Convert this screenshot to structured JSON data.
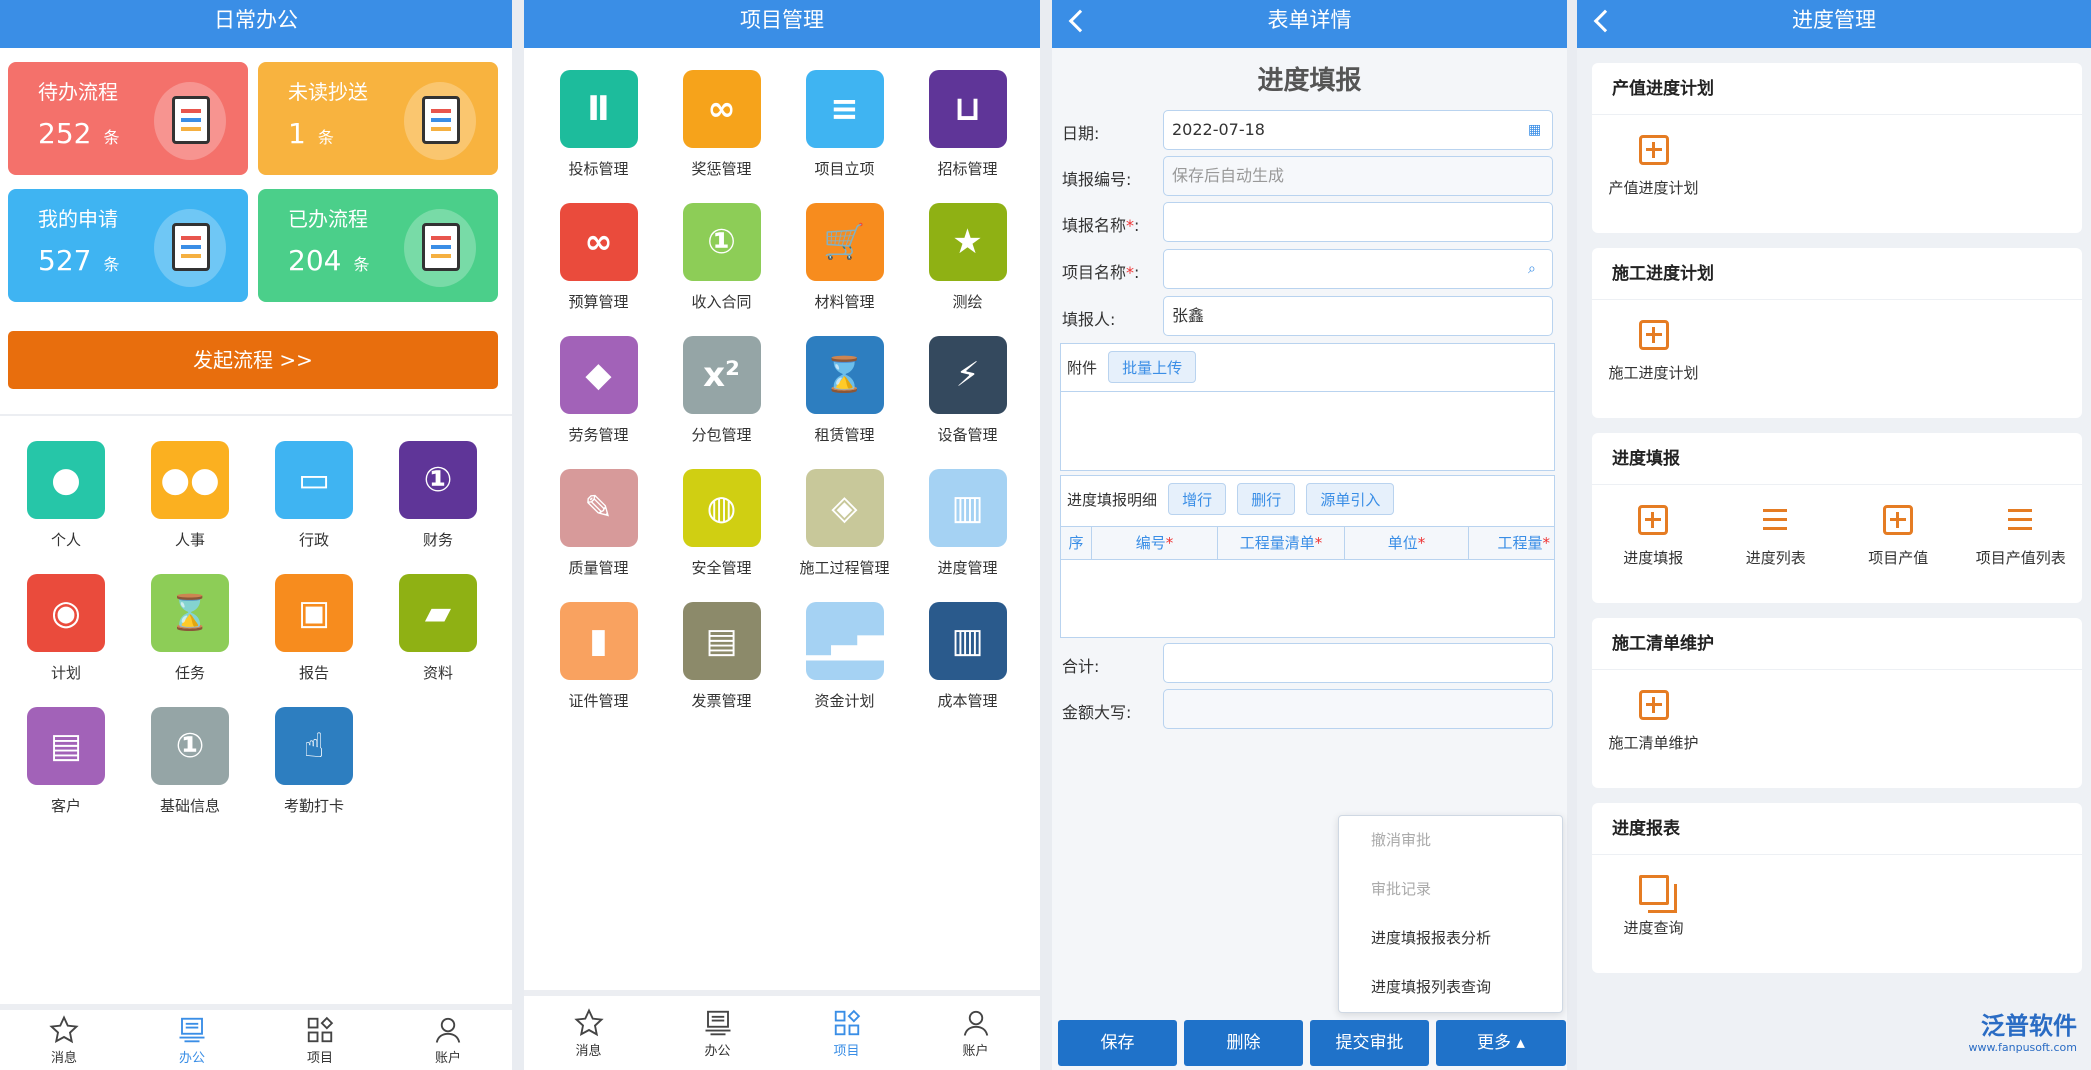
{
  "office": {
    "title": "日常办公",
    "cards": [
      {
        "label": "待办流程",
        "count": "252",
        "unit": "条",
        "color": "#f4716b",
        "icon": "calendar-icon"
      },
      {
        "label": "未读抄送",
        "count": "1",
        "unit": "条",
        "color": "#f8b33f",
        "icon": "envelope-icon"
      },
      {
        "label": "我的申请",
        "count": "527",
        "unit": "条",
        "color": "#3fb4f2",
        "icon": "binders-icon"
      },
      {
        "label": "已办流程",
        "count": "204",
        "unit": "条",
        "color": "#4bcf8a",
        "icon": "clipboard-icon"
      }
    ],
    "start_button": "发起流程 >>",
    "apps": [
      {
        "label": "个人",
        "color": "#26c6a8",
        "icon": "person-icon",
        "glyph": "●"
      },
      {
        "label": "人事",
        "color": "#fbb020",
        "icon": "group-icon",
        "glyph": "●●"
      },
      {
        "label": "行政",
        "color": "#3fb4f2",
        "icon": "window-icon",
        "glyph": "▭"
      },
      {
        "label": "财务",
        "color": "#5f3598",
        "icon": "money-icon",
        "glyph": "①"
      },
      {
        "label": "计划",
        "color": "#ea4b3c",
        "icon": "github-icon",
        "glyph": "◉"
      },
      {
        "label": "任务",
        "color": "#8dcd57",
        "icon": "hourglass-icon",
        "glyph": "⌛"
      },
      {
        "label": "报告",
        "color": "#f78c1e",
        "icon": "monitor-icon",
        "glyph": "▣"
      },
      {
        "label": "资料",
        "color": "#8fb114",
        "icon": "folder-icon",
        "glyph": "▰"
      },
      {
        "label": "客户",
        "color": "#a262b8",
        "icon": "contact-icon",
        "glyph": "▤"
      },
      {
        "label": "基础信息",
        "color": "#95a5a6",
        "icon": "cash-icon",
        "glyph": "①"
      },
      {
        "label": "考勤打卡",
        "color": "#2d7ec0",
        "icon": "hand-pointer-icon",
        "glyph": "☝"
      }
    ],
    "tabs": [
      {
        "label": "消息",
        "icon": "star-icon"
      },
      {
        "label": "办公",
        "icon": "desk-icon"
      },
      {
        "label": "项目",
        "icon": "grid-icon"
      },
      {
        "label": "账户",
        "icon": "user-icon"
      }
    ]
  },
  "project": {
    "title": "项目管理",
    "apps": [
      {
        "label": "投标管理",
        "color": "#1dbc9c",
        "icon": "road-icon",
        "glyph": "Ⅱ"
      },
      {
        "label": "奖惩管理",
        "color": "#f6a31b",
        "icon": "cloud-icon",
        "glyph": "∞"
      },
      {
        "label": "项目立项",
        "color": "#3fb4f2",
        "icon": "message-icon",
        "glyph": "≡"
      },
      {
        "label": "招标管理",
        "color": "#5f3598",
        "icon": "inbox-icon",
        "glyph": "⊔"
      },
      {
        "label": "预算管理",
        "color": "#ea4b3c",
        "icon": "cloud-icon",
        "glyph": "∞"
      },
      {
        "label": "收入合同",
        "color": "#8dcd57",
        "icon": "money-icon",
        "glyph": "①"
      },
      {
        "label": "材料管理",
        "color": "#f78c1e",
        "icon": "cart-icon",
        "glyph": "🛒"
      },
      {
        "label": "测绘",
        "color": "#8fb114",
        "icon": "star-icon",
        "glyph": "★"
      },
      {
        "label": "劳务管理",
        "color": "#a262b8",
        "icon": "gitlab-icon",
        "glyph": "◆"
      },
      {
        "label": "分包管理",
        "color": "#95a5a6",
        "icon": "superscript-icon",
        "glyph": "x²"
      },
      {
        "label": "租赁管理",
        "color": "#2d7ec0",
        "icon": "hourglass-icon",
        "glyph": "⌛"
      },
      {
        "label": "设备管理",
        "color": "#34495e",
        "icon": "plug-icon",
        "glyph": "⚡"
      },
      {
        "label": "质量管理",
        "color": "#d79a9a",
        "icon": "edit-icon",
        "glyph": "✎"
      },
      {
        "label": "安全管理",
        "color": "#d0cf12",
        "icon": "chat-icon",
        "glyph": "◍"
      },
      {
        "label": "施工过程管理",
        "color": "#c8c89a",
        "icon": "compass-icon",
        "glyph": "◈"
      },
      {
        "label": "进度管理",
        "color": "#a5d2f3",
        "icon": "bar-chart-icon",
        "glyph": "▥"
      },
      {
        "label": "证件管理",
        "color": "#f9a260",
        "icon": "tie-icon",
        "glyph": "▮"
      },
      {
        "label": "发票管理",
        "color": "#8c8a6a",
        "icon": "file-icon",
        "glyph": "▤"
      },
      {
        "label": "资金计划",
        "color": "#a5d2f3",
        "icon": "signal-icon",
        "glyph": "▁▃▅"
      },
      {
        "label": "成本管理",
        "color": "#2a5a8c",
        "icon": "bar-chart-icon",
        "glyph": "▥"
      }
    ],
    "tabs": [
      {
        "label": "消息",
        "icon": "star-icon"
      },
      {
        "label": "办公",
        "icon": "desk-icon"
      },
      {
        "label": "项目",
        "icon": "grid-icon"
      },
      {
        "label": "账户",
        "icon": "user-icon"
      }
    ]
  },
  "form": {
    "title": "表单详情",
    "heading": "进度填报",
    "fields": {
      "date_label": "日期:",
      "date_value": "2022-07-18",
      "code_label": "填报编号:",
      "code_placeholder": "保存后自动生成",
      "name_label": "填报名称",
      "project_label": "项目名称",
      "reporter_label": "填报人:",
      "reporter_value": "张鑫",
      "attach_label": "附件",
      "upload_button": "批量上传",
      "detail_label": "进度填报明细",
      "add_row": "增行",
      "del_row": "删行",
      "import": "源单引入",
      "columns": [
        "序",
        "编号",
        "工程量清单",
        "单位",
        "工程量"
      ],
      "total_label": "合计:",
      "amount_label": "金额大写:"
    },
    "menu": [
      "撤消审批",
      "审批记录",
      "进度填报报表分析",
      "进度填报列表查询"
    ],
    "buttons": {
      "save": "保存",
      "delete": "删除",
      "submit": "提交审批",
      "more": "更多 ▴"
    }
  },
  "progress": {
    "title": "进度管理",
    "sections": [
      {
        "title": "产值进度计划",
        "items": [
          {
            "label": "产值进度计划",
            "icon": "plus-square-icon"
          }
        ]
      },
      {
        "title": "施工进度计划",
        "items": [
          {
            "label": "施工进度计划",
            "icon": "plus-square-icon"
          }
        ]
      },
      {
        "title": "进度填报",
        "items": [
          {
            "label": "进度填报",
            "icon": "plus-square-icon"
          },
          {
            "label": "进度列表",
            "icon": "list-icon"
          },
          {
            "label": "项目产值",
            "icon": "plus-square-icon"
          },
          {
            "label": "项目产值列表",
            "icon": "list-icon"
          }
        ]
      },
      {
        "title": "施工清单维护",
        "items": [
          {
            "label": "施工清单维护",
            "icon": "plus-square-icon"
          }
        ]
      },
      {
        "title": "进度报表",
        "items": [
          {
            "label": "进度查询",
            "icon": "copy-icon"
          }
        ]
      }
    ],
    "logo": {
      "name": "泛普软件",
      "url": "www.fanpusoft.com"
    }
  }
}
